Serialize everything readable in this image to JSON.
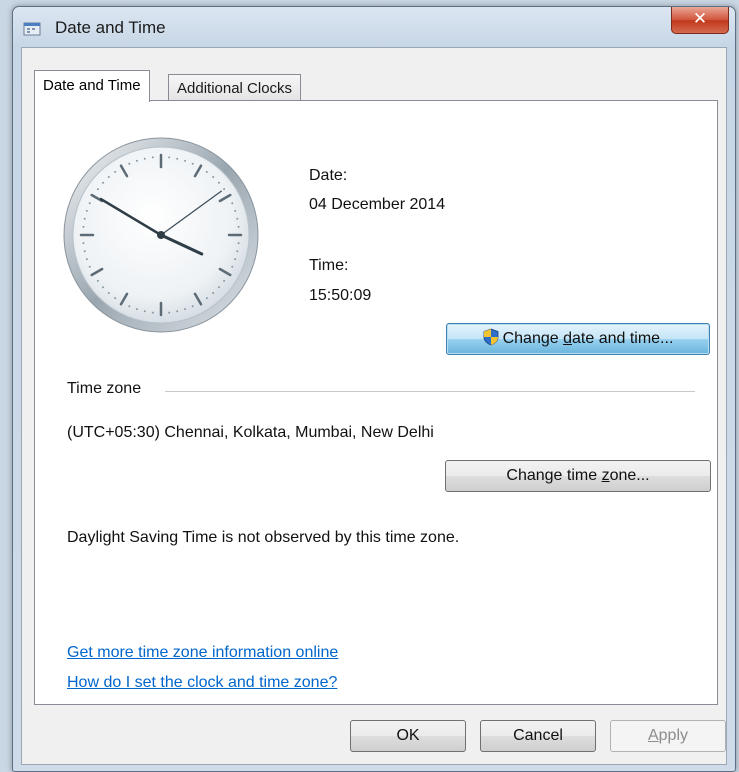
{
  "window": {
    "title": "Date and Time",
    "close_glyph": "✕"
  },
  "tabs": [
    {
      "label": "Date and Time",
      "active": true
    },
    {
      "label": "Additional Clocks",
      "active": false
    }
  ],
  "clock": {
    "icon": "analog-clock-face",
    "time_shown": "15:50:09"
  },
  "date_section": {
    "date_label": "Date:",
    "date_value": "04 December 2014",
    "time_label": "Time:",
    "time_value": "15:50:09"
  },
  "buttons": {
    "change_datetime": {
      "pre": "Change ",
      "accel": "d",
      "post": "ate and time...",
      "icon": "uac-shield-icon"
    },
    "change_timezone": {
      "pre": "Change time ",
      "accel": "z",
      "post": "one..."
    },
    "ok": "OK",
    "cancel": "Cancel",
    "apply": {
      "accel": "A",
      "post": "pply"
    }
  },
  "timezone": {
    "heading": "Time zone",
    "value": "(UTC+05:30) Chennai, Kolkata, Mumbai, New Delhi",
    "dst_note": "Daylight Saving Time is not observed by this time zone."
  },
  "links": {
    "more_info": "Get more time zone information online",
    "how_to": "How do I set the clock and time zone?"
  },
  "colors": {
    "link": "#0066cc",
    "close_button": "#c7432a",
    "focused_button": "#98d1ef"
  }
}
